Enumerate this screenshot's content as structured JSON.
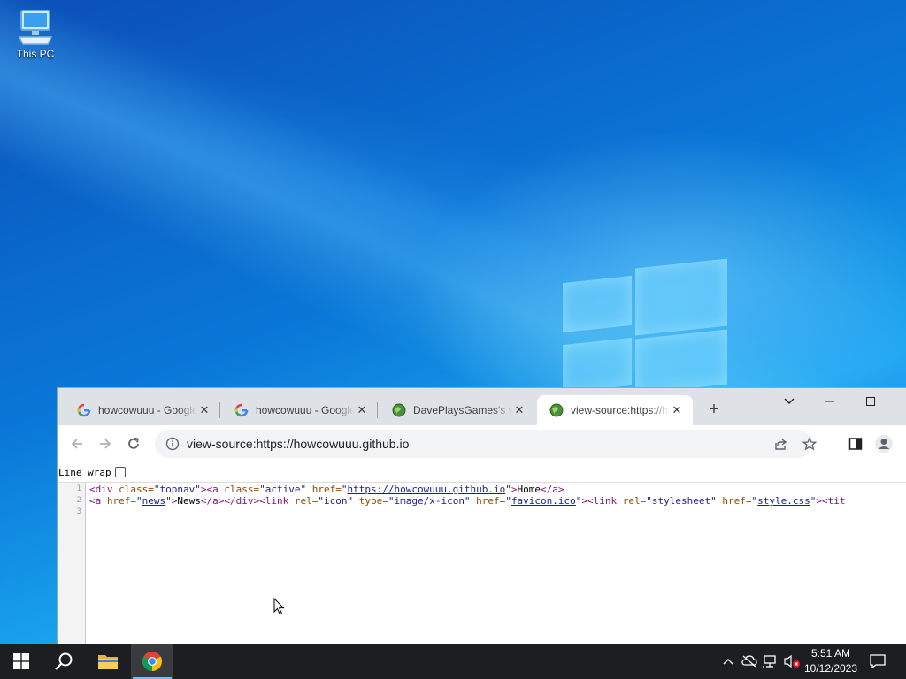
{
  "desktop": {
    "icons": [
      {
        "label": "This PC",
        "icon": "this-pc-icon"
      }
    ]
  },
  "browser": {
    "tabs": [
      {
        "title": "howcowuuu - Google Search",
        "favicon": "google-icon",
        "active": false
      },
      {
        "title": "howcowuuu - Google Search",
        "favicon": "google-icon",
        "active": false
      },
      {
        "title": "DavePlaysGames's website",
        "favicon": "globe-icon",
        "active": false
      },
      {
        "title": "view-source:https://howcowuuu.github.io",
        "favicon": "globe-icon",
        "active": true
      }
    ],
    "new_tab": "+",
    "address": "view-source:https://howcowuuu.github.io",
    "line_wrap_label": "Line wrap",
    "line_wrap_checked": false,
    "line_numbers": [
      "1",
      "2",
      "3"
    ],
    "source": {
      "line1": {
        "t1": "<div ",
        "a1": "class=",
        "v1": "\"topnav\"",
        "t2": "><a ",
        "a2": "class=",
        "v2": "\"active\"",
        "a3": " href=",
        "q1": "\"",
        "link": "https://howcowuuu.github.io",
        "q2": "\"",
        "t3": ">",
        "text": "Home",
        "t4": "</a>"
      },
      "line2": {
        "t1": "<a ",
        "a1": "href=",
        "q1": "\"",
        "link1": "news",
        "q2": "\"",
        "t2": ">",
        "text1": "News",
        "t3": "</a></div><link ",
        "a2": "rel=",
        "v2": "\"icon\"",
        "a3": " type=",
        "v3": "\"image/x-icon\"",
        "a4": " href=",
        "q3": "\"",
        "link2": "favicon.ico",
        "q4": "\"",
        "t4": "><link ",
        "a5": "rel=",
        "v5": "\"stylesheet\"",
        "a6": " href=",
        "q5": "\"",
        "link3": "style.css",
        "q6": "\"",
        "t5": "><tit"
      }
    }
  },
  "taskbar": {
    "clock_time": "5:51 AM",
    "clock_date": "10/12/2023"
  },
  "colors": {
    "accent": "#1a73e8",
    "taskbar": "#1d1e22",
    "desktop": "#0a78d8"
  }
}
